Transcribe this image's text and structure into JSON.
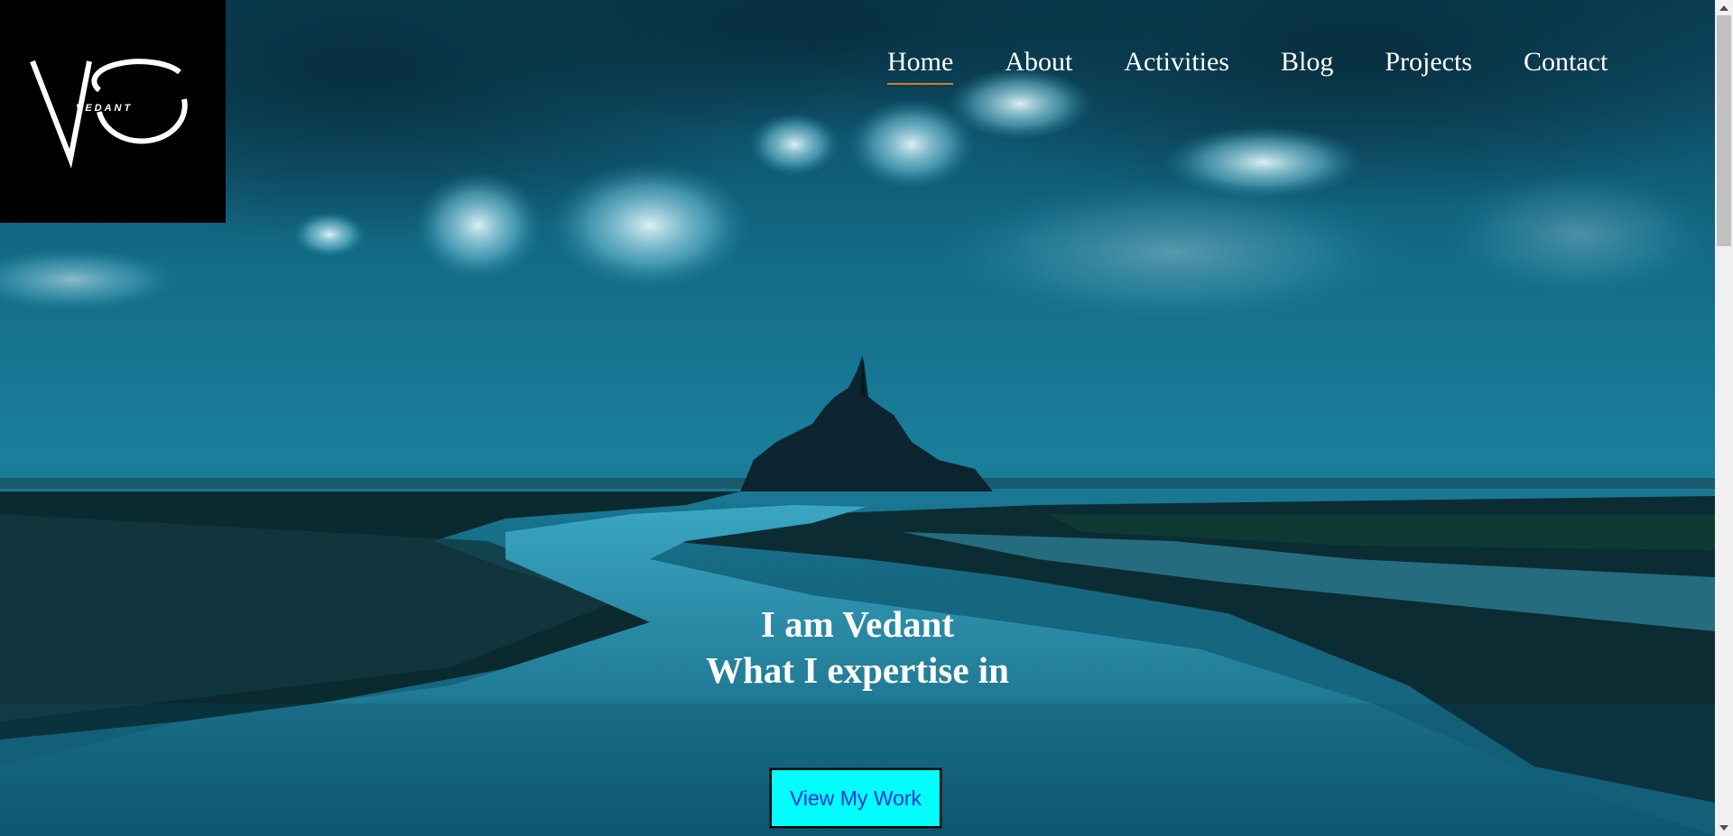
{
  "logo": {
    "wordmark": "VEDANT"
  },
  "nav": {
    "items": [
      {
        "label": "Home",
        "active": true
      },
      {
        "label": "About",
        "active": false
      },
      {
        "label": "Activities",
        "active": false
      },
      {
        "label": "Blog",
        "active": false
      },
      {
        "label": "Projects",
        "active": false
      },
      {
        "label": "Contact",
        "active": false
      }
    ],
    "active_underline_color": "#d97a2b"
  },
  "hero": {
    "line1": "I am Vedant",
    "line2": "What I expertise in",
    "cta_label": "View My Work",
    "cta_bg": "#00ffff",
    "cta_text_color": "#2233d6"
  }
}
